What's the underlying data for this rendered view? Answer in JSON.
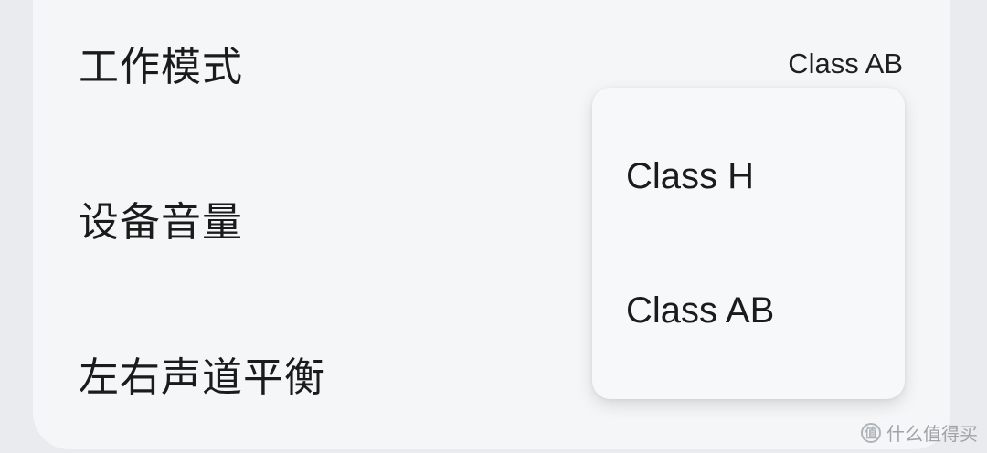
{
  "settings": {
    "rows": [
      {
        "label": "工作模式",
        "value": "Class AB"
      },
      {
        "label": "设备音量"
      },
      {
        "label": "左右声道平衡"
      }
    ]
  },
  "dropdown": {
    "options": [
      {
        "label": "Class H"
      },
      {
        "label": "Class AB"
      }
    ]
  },
  "watermark": {
    "logo_glyph": "值",
    "text": "什么值得买"
  }
}
